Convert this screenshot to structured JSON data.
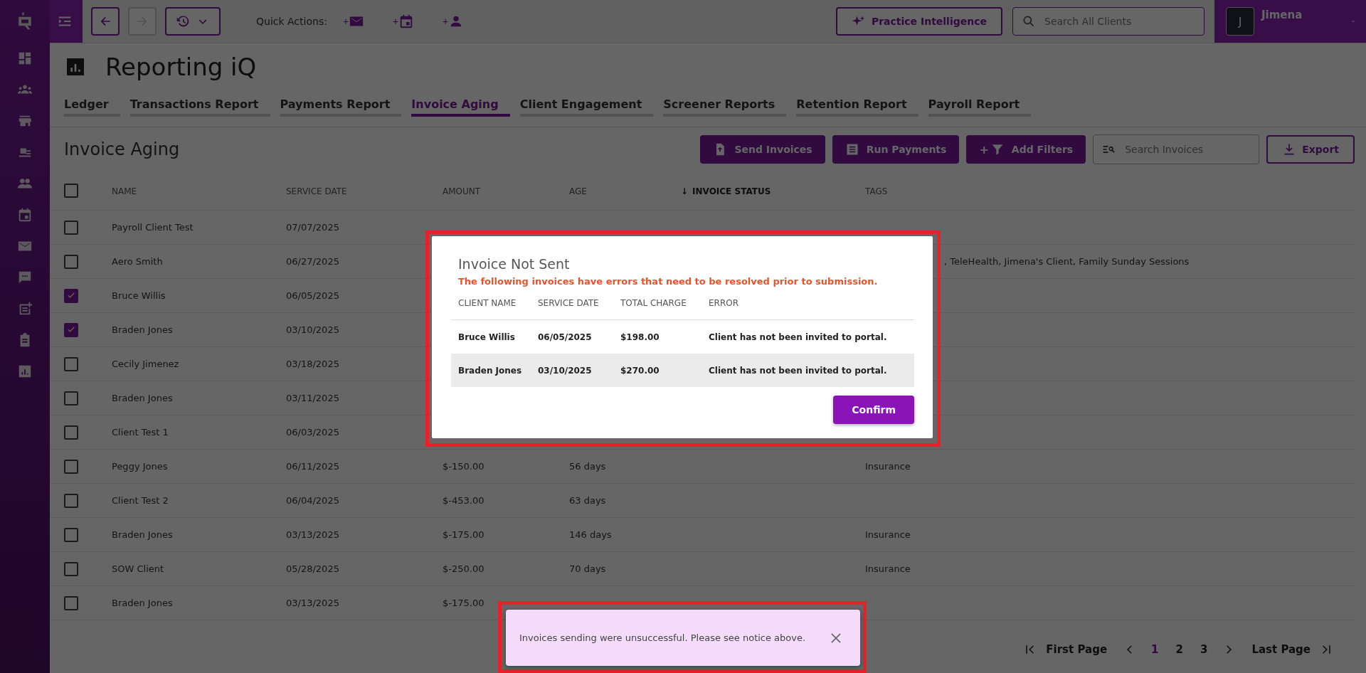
{
  "topbar": {
    "quick_actions_label": "Quick Actions:",
    "quick_actions": [
      {
        "plus": "+"
      },
      {
        "plus": "+"
      },
      {
        "plus": "+"
      }
    ],
    "practice_button": "Practice Intelligence",
    "search": {
      "placeholder": "Search All Clients"
    },
    "user": {
      "initial": "J",
      "name": "Jimena"
    }
  },
  "page": {
    "title": "Reporting iQ"
  },
  "tabs": [
    {
      "label": "Ledger",
      "selected": false
    },
    {
      "label": "Transactions Report",
      "selected": false
    },
    {
      "label": "Payments Report",
      "selected": false
    },
    {
      "label": "Invoice Aging",
      "selected": true
    },
    {
      "label": "Client Engagement",
      "selected": false
    },
    {
      "label": "Screener Reports",
      "selected": false
    },
    {
      "label": "Retention Report",
      "selected": false
    },
    {
      "label": "Payroll Report",
      "selected": false
    }
  ],
  "section": {
    "title": "Invoice Aging",
    "buttons": [
      {
        "label": "Send Invoices"
      },
      {
        "label": "Run Payments"
      },
      {
        "label": "Add Filters",
        "plus": "+"
      }
    ],
    "search": {
      "placeholder": "Search Invoices"
    },
    "export": "Export"
  },
  "table": {
    "all_checked": false,
    "columns": [
      {
        "label": "NAME"
      },
      {
        "label": "SERVICE DATE"
      },
      {
        "label": "AMOUNT"
      },
      {
        "label": "AGE"
      },
      {
        "label": "INVOICE STATUS",
        "sort_arrow": "↓"
      },
      {
        "label": "TAGS"
      }
    ],
    "rows": [
      {
        "checked": false,
        "name": "Payroll Client Test",
        "date": "07/07/2025"
      },
      {
        "checked": false,
        "name": "Aero Smith",
        "date": "06/27/2025",
        "tags": ", TeleHealth, Jimena's Client, Family Sunday Sessions"
      },
      {
        "checked": true,
        "name": "Bruce Willis",
        "date": "06/05/2025"
      },
      {
        "checked": true,
        "name": "Braden Jones",
        "date": "03/10/2025"
      },
      {
        "checked": false,
        "name": "Cecily Jimenez",
        "date": "03/18/2025"
      },
      {
        "checked": false,
        "name": "Braden Jones",
        "date": "03/11/2025"
      },
      {
        "checked": false,
        "name": "Client Test 1",
        "date": "06/03/2025"
      },
      {
        "checked": false,
        "name": "Peggy Jones",
        "date": "06/11/2025",
        "amount": "$-150.00",
        "age": "56 days",
        "tags": "Insurance"
      },
      {
        "checked": false,
        "name": "Client Test 2",
        "date": "06/04/2025",
        "amount": "$-453.00",
        "age": "63 days"
      },
      {
        "checked": false,
        "name": "Braden Jones",
        "date": "03/13/2025",
        "amount": "$-175.00",
        "age": "146 days",
        "tags": "Insurance"
      },
      {
        "checked": false,
        "name": "SOW Client",
        "date": "05/28/2025",
        "amount": "$-250.00",
        "age": "70 days",
        "tags": "Insurance"
      },
      {
        "checked": false,
        "name": "Braden Jones",
        "date": "03/13/2025",
        "amount": "$-175.00"
      }
    ]
  },
  "pagination": {
    "first": "First Page",
    "pages": [
      {
        "label": "1",
        "selected": true
      },
      {
        "label": "2",
        "selected": false
      },
      {
        "label": "3",
        "selected": false
      }
    ],
    "last": "Last Page"
  },
  "dialog": {
    "title": "Invoice Not Sent",
    "message": "The following invoices have errors that need to be resolved prior to submission.",
    "columns": [
      "CLIENT NAME",
      "SERVICE DATE",
      "TOTAL CHARGE",
      "ERROR"
    ],
    "rows": [
      [
        "Bruce Willis",
        "06/05/2025",
        "$198.00",
        "Client has not been invited to portal."
      ],
      [
        "Braden Jones",
        "03/10/2025",
        "$270.00",
        "Client has not been invited to portal."
      ]
    ],
    "confirm": "Confirm"
  },
  "toast": {
    "message": "Invoices sending were unsuccessful. Please see notice above."
  }
}
